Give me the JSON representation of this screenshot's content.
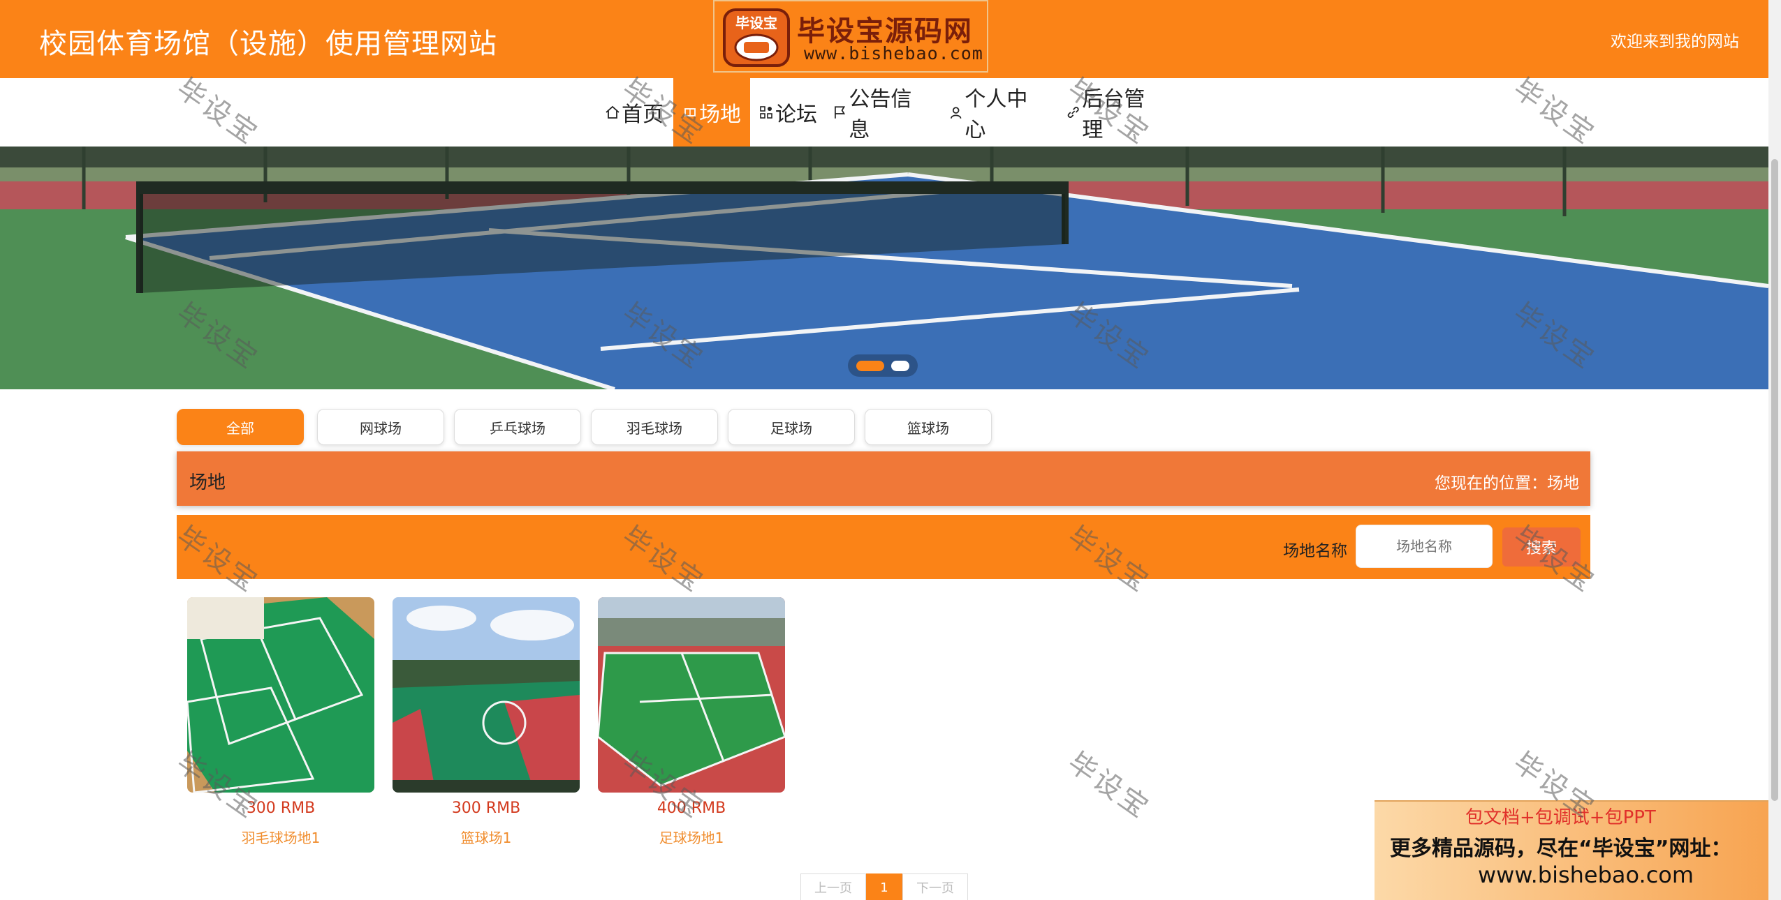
{
  "header": {
    "site_title": "校园体育场馆（设施）使用管理网站",
    "welcome": "欢迎来到我的网站",
    "logo_text": "毕设宝源码网",
    "logo_url": "www.bishebao.com",
    "logo_badge": "毕设宝"
  },
  "nav": {
    "items": [
      {
        "label": "首页",
        "icon": "home-icon"
      },
      {
        "label": "场地",
        "icon": "venue-icon",
        "active": true
      },
      {
        "label": "论坛",
        "icon": "grid-icon"
      },
      {
        "label": "公告信息",
        "icon": "flag-icon"
      },
      {
        "label": "个人中心",
        "icon": "user-icon"
      },
      {
        "label": "后台管理",
        "icon": "link-icon"
      }
    ]
  },
  "carousel": {
    "slides": 2,
    "active_slide": 1
  },
  "categories": {
    "items": [
      "全部",
      "网球场",
      "乒乓球场",
      "羽毛球场",
      "足球场",
      "篮球场"
    ],
    "active": "全部"
  },
  "section": {
    "title": "场地",
    "breadcrumb": "您现在的位置：场地"
  },
  "search": {
    "label": "场地名称",
    "placeholder": "场地名称",
    "button": "搜索"
  },
  "venues": [
    {
      "price": "300 RMB",
      "name": "羽毛球场地1"
    },
    {
      "price": "300 RMB",
      "name": "篮球场1"
    },
    {
      "price": "400 RMB",
      "name": "足球场地1"
    }
  ],
  "pagination": {
    "prev": "上一页",
    "current": "1",
    "next": "下一页"
  },
  "ad": {
    "line1": "包文档+包调试+包PPT",
    "line2": "更多精品源码，尽在“毕设宝”网址：",
    "line3": "www.bishebao.com"
  },
  "watermark": "毕设宝",
  "colors": {
    "primary": "#fb8317",
    "section_bar": "#f07838",
    "price": "#d33a1e",
    "venue_name": "#f08c2c"
  }
}
